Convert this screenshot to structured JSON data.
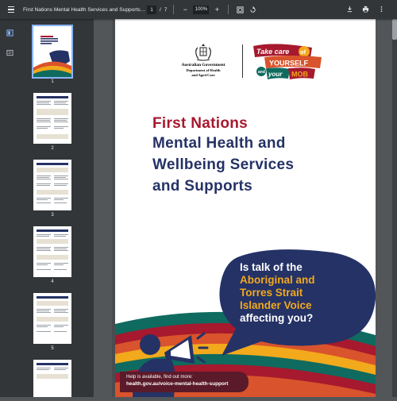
{
  "toolbar": {
    "title": "First Nations Mental Health Services and Supports Conta...",
    "current_page": "1",
    "page_sep": "/",
    "total_pages": "7",
    "zoom": "100%",
    "zoom_out_label": "−",
    "zoom_in_label": "+",
    "icons": [
      "menu-icon",
      "fit-page-icon",
      "rotate-icon",
      "download-icon",
      "print-icon",
      "more-icon"
    ]
  },
  "sidebar": {
    "thumbnails": [
      {
        "label": "1"
      },
      {
        "label": "2"
      },
      {
        "label": "3"
      },
      {
        "label": "4"
      },
      {
        "label": "5"
      }
    ]
  },
  "page": {
    "gov": {
      "line1": "Australian Government",
      "line2": "Department of Health",
      "line3": "and Aged Care"
    },
    "tc_logo": {
      "line1": "Take care",
      "of": "of",
      "yourself": "YOURSELF",
      "and": "and",
      "your": "your",
      "mob": "MOB"
    },
    "headline": {
      "line1": "First Nations",
      "line2": "Mental Health and",
      "line3": "Wellbeing Services",
      "line4": "and Supports"
    },
    "bubble": {
      "line1": "Is talk of the",
      "line2": "Aboriginal and",
      "line3": "Torres Strait",
      "line4": "Islander Voice",
      "line5": "affecting you?"
    },
    "help": {
      "line1": "Help is available, find out more:",
      "line2": "health.gov.au/voice-mental-health-support"
    }
  },
  "colors": {
    "red": "#a6192e",
    "navy": "#253266",
    "yellow": "#f2a91c",
    "toolbar": "#323639"
  }
}
